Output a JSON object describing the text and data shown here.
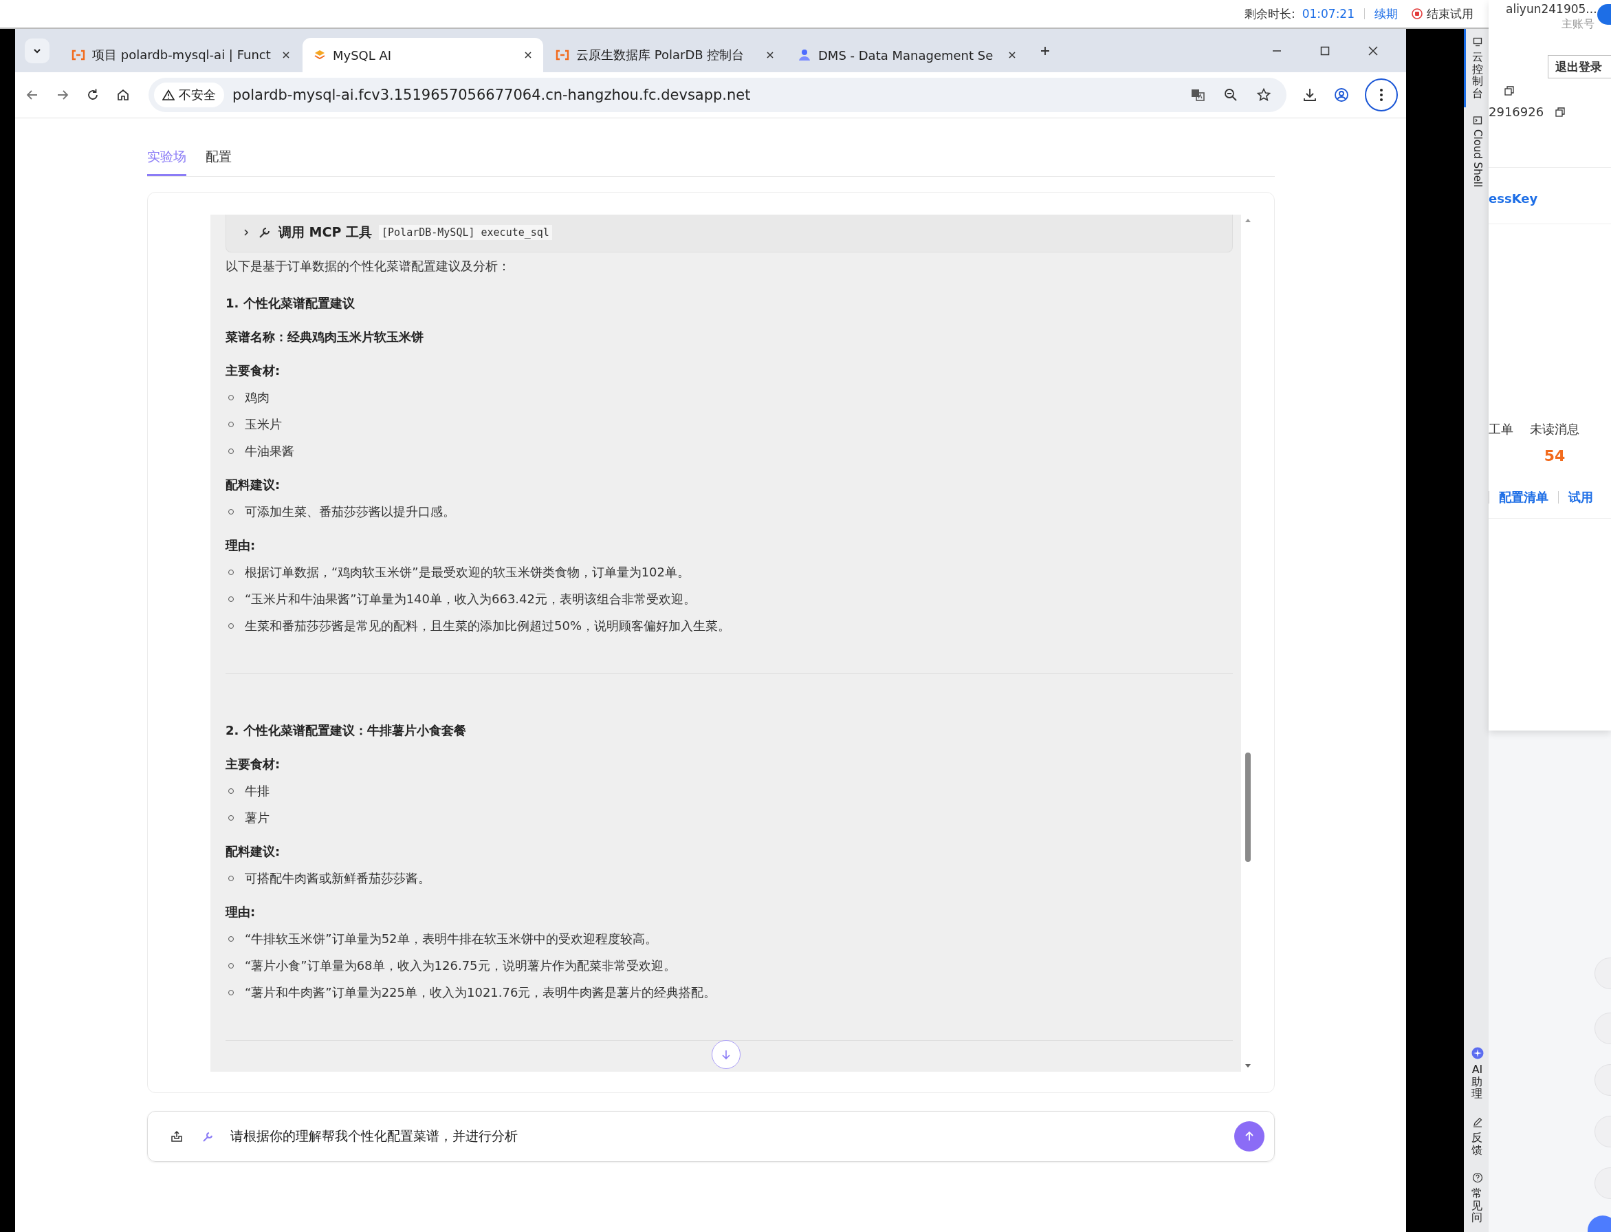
{
  "top_bar": {
    "remaining_label": "剩余时长:",
    "remaining_time": "01:07:21",
    "renew_link": "续期",
    "end_trial": "结束试用"
  },
  "account": {
    "name": "aliyun241905...",
    "role": "主账号"
  },
  "browser": {
    "tabs": [
      {
        "title": "项目 polardb-mysql-ai | Funct",
        "selected": false
      },
      {
        "title": "MySQL AI",
        "selected": true
      },
      {
        "title": "云原生数据库 PolarDB 控制台",
        "selected": false
      },
      {
        "title": "DMS - Data Management Se",
        "selected": false
      }
    ],
    "security_label": "不安全",
    "url": "polardb-mysql-ai.fcv3.1519657056677064.cn-hangzhou.fc.devsapp.net"
  },
  "page_tabs": [
    {
      "label": "实验场",
      "selected": true
    },
    {
      "label": "配置",
      "selected": false
    }
  ],
  "tool_call": {
    "label": "调用 MCP 工具",
    "code": "[PolarDB-MySQL] execute_sql",
    "expanded": false
  },
  "message": {
    "intro": "以下是基于订单数据的个性化菜谱配置建议及分析：",
    "sections": [
      {
        "title": "1. 个性化菜谱配置建议",
        "recipe": "菜谱名称：经典鸡肉玉米片软玉米饼",
        "groups": [
          {
            "heading": "主要食材:",
            "items": [
              "鸡肉",
              "玉米片",
              "牛油果酱"
            ]
          },
          {
            "heading": "配料建议:",
            "items": [
              "可添加生菜、番茄莎莎酱以提升口感。"
            ]
          },
          {
            "heading": "理由:",
            "items": [
              "根据订单数据，“鸡肉软玉米饼”是最受欢迎的软玉米饼类食物，订单量为102单。",
              "“玉米片和牛油果酱”订单量为140单，收入为663.42元，表明该组合非常受欢迎。",
              "生菜和番茄莎莎酱是常见的配料，且生菜的添加比例超过50%，说明顾客偏好加入生菜。"
            ]
          }
        ]
      },
      {
        "title": "2. 个性化菜谱配置建议：牛排薯片小食套餐",
        "groups": [
          {
            "heading": "主要食材:",
            "items": [
              "牛排",
              "薯片"
            ]
          },
          {
            "heading": "配料建议:",
            "items": [
              "可搭配牛肉酱或新鲜番茄莎莎酱。"
            ]
          },
          {
            "heading": "理由:",
            "items": [
              "“牛排软玉米饼”订单量为52单，表明牛排在软玉米饼中的受欢迎程度较高。",
              "“薯片小食”订单量为68单，收入为126.75元，说明薯片作为配菜非常受欢迎。",
              "“薯片和牛肉酱”订单量为225单，收入为1021.76元，表明牛肉酱是薯片的经典搭配。"
            ]
          }
        ]
      }
    ]
  },
  "input": {
    "value": "请根据你的理解帮我个性化配置菜谱，并进行分析"
  },
  "side_panel": {
    "logout_button": "退出登录",
    "account_id": "2916926",
    "access_key_link": "essKey",
    "stats": [
      {
        "label": "工单"
      },
      {
        "label": "未读消息",
        "value": "54"
      }
    ],
    "links": [
      "配置清单",
      "试用"
    ]
  },
  "sidebar": {
    "top_items": [
      {
        "label": "云控制台",
        "kind": "console",
        "selected": true
      },
      {
        "label": "Cloud Shell",
        "kind": "shell",
        "selected": false
      }
    ],
    "bottom_items": [
      {
        "label": "AI助理",
        "kind": "ai"
      },
      {
        "label": "反馈",
        "kind": "feedback"
      },
      {
        "label": "常见问",
        "kind": "help"
      }
    ]
  }
}
